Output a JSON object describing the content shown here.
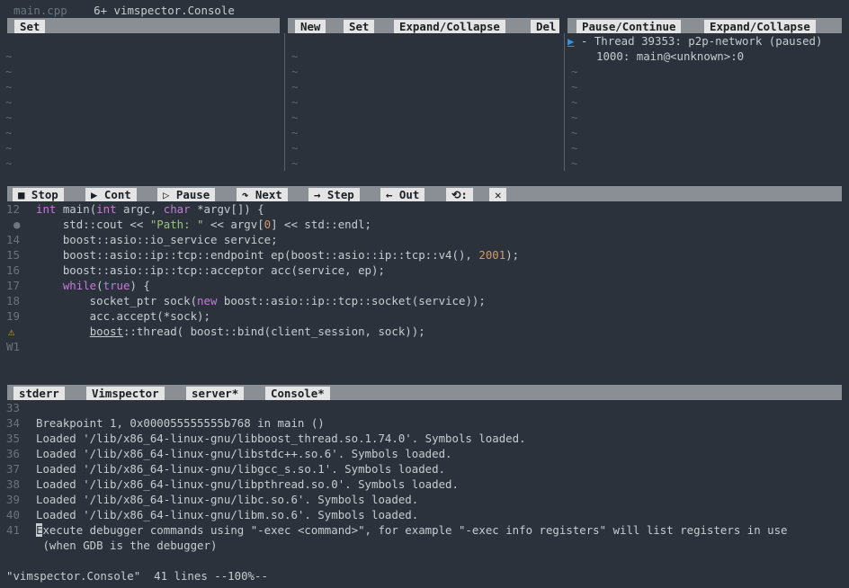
{
  "tabline": {
    "tab1": "main.cpp",
    "tab2": "6+ vimspector.Console"
  },
  "variables": {
    "set_label": "Set"
  },
  "watches": {
    "new_label": "New",
    "set_label": "Set",
    "expand_label": "Expand/Collapse",
    "del_label": "Del"
  },
  "stack": {
    "pause_label": "Pause/Continue",
    "expand_label": "Expand/Collapse",
    "thread_marker": "▶",
    "thread_line": " - Thread 39353: p2p-network (paused)",
    "frame_line": "1000: main@<unknown>:0"
  },
  "code_toolbar": {
    "stop": "■ Stop",
    "cont": "▶ Cont",
    "pause": "▷ Pause",
    "next": "↷ Next",
    "step": "→ Step",
    "out": "← Out",
    "restart": "⟲:",
    "close": "✕"
  },
  "code": {
    "lines": [
      {
        "n": "12",
        "t": "int main(int argc, char *argv[]) {"
      },
      {
        "n": "●",
        "t": "    std::cout << \"Path: \" << argv[0] << std::endl;"
      },
      {
        "n": "14",
        "t": "    boost::asio::io_service service;"
      },
      {
        "n": "15",
        "t": "    boost::asio::ip::tcp::endpoint ep(boost::asio::ip::tcp::v4(), 2001);"
      },
      {
        "n": "16",
        "t": "    boost::asio::ip::tcp::acceptor acc(service, ep);"
      },
      {
        "n": "17",
        "t": "    while(true) {"
      },
      {
        "n": "18",
        "t": "        socket_ptr sock(new boost::asio::ip::tcp::socket(service));"
      },
      {
        "n": "19",
        "t": "        acc.accept(*sock);"
      },
      {
        "n": "⚠",
        "t": "        boost::thread( boost::bind(client_session, sock));"
      }
    ],
    "winbar": "W1"
  },
  "output_tabs": {
    "stderr": "stderr",
    "vimspector": "Vimspector",
    "server": "server*",
    "console": "Console*"
  },
  "console": {
    "lines": [
      {
        "n": "33",
        "t": ""
      },
      {
        "n": "34",
        "t": "Breakpoint 1, 0x000055555555b768 in main ()"
      },
      {
        "n": "35",
        "t": "Loaded '/lib/x86_64-linux-gnu/libboost_thread.so.1.74.0'. Symbols loaded."
      },
      {
        "n": "36",
        "t": "Loaded '/lib/x86_64-linux-gnu/libstdc++.so.6'. Symbols loaded."
      },
      {
        "n": "37",
        "t": "Loaded '/lib/x86_64-linux-gnu/libgcc_s.so.1'. Symbols loaded."
      },
      {
        "n": "38",
        "t": "Loaded '/lib/x86_64-linux-gnu/libpthread.so.0'. Symbols loaded."
      },
      {
        "n": "39",
        "t": "Loaded '/lib/x86_64-linux-gnu/libc.so.6'. Symbols loaded."
      },
      {
        "n": "40",
        "t": "Loaded '/lib/x86_64-linux-gnu/libm.so.6'. Symbols loaded."
      },
      {
        "n": "41",
        "t": "Execute debugger commands using \"-exec <command>\", for example \"-exec info registers\" will list registers in use"
      },
      {
        "n": "",
        "t": " (when GDB is the debugger)"
      }
    ]
  },
  "status": {
    "text": "\"vimspector.Console\"  41 lines --100%--"
  },
  "colors": {
    "background": "#2b323b",
    "button_bg": "#e4e4e4",
    "toolbar_bg": "#8a8f95",
    "keyword": "#c678dd",
    "string": "#98c379",
    "number": "#d19a66"
  }
}
